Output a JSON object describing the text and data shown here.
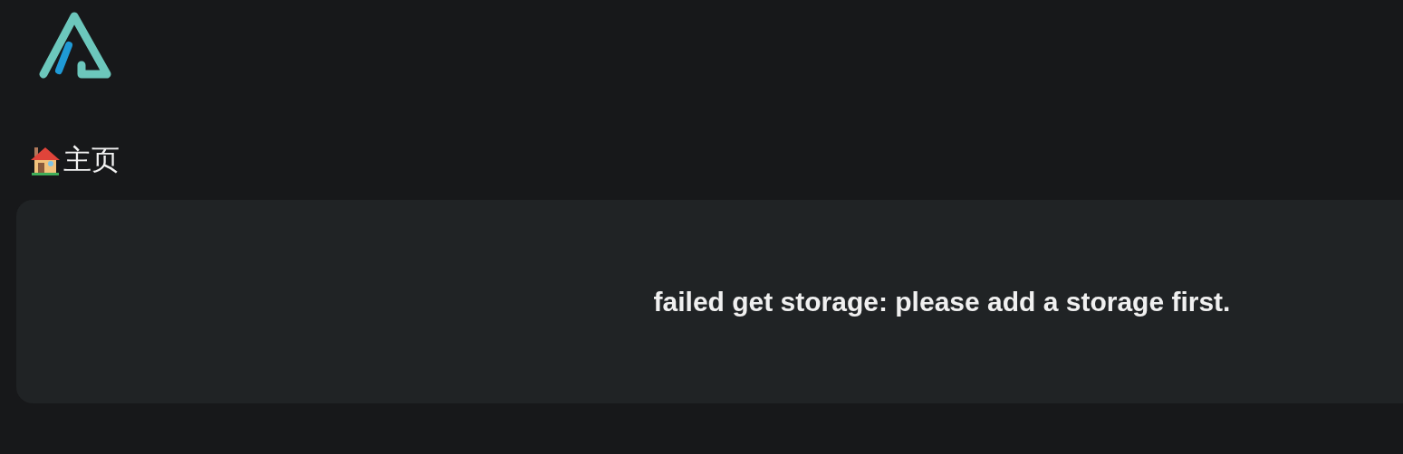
{
  "breadcrumb": {
    "label": "主页"
  },
  "message": "failed get storage: please add a storage first."
}
